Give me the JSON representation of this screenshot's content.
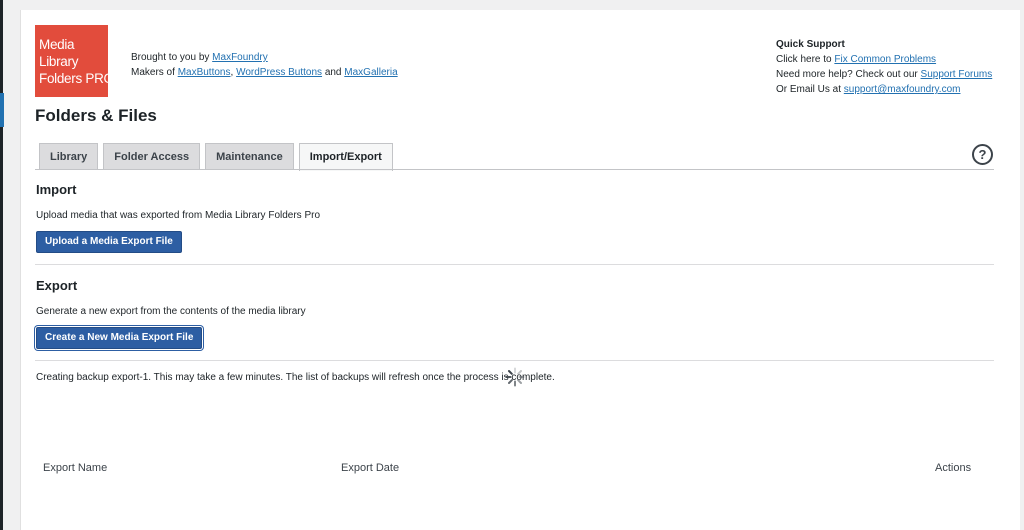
{
  "logo": {
    "lines": [
      "Media",
      "Library",
      "Folders PRO"
    ]
  },
  "credits": {
    "brought_prefix": "Brought to you by",
    "brought_link": "MaxFoundry",
    "makers_prefix": "Makers of",
    "maxbuttons": "MaxButtons",
    "comma": ",",
    "wordpress_buttons": "WordPress Buttons",
    "and": "and",
    "maxgalleria": "MaxGalleria"
  },
  "support": {
    "title": "Quick Support",
    "click_prefix": "Click here to",
    "fix_link": "Fix Common Problems",
    "help_prefix": "Need more help? Check out our",
    "forums_link": "Support Forums",
    "email_prefix": "Or Email Us at",
    "email_link": "support@maxfoundry.com"
  },
  "page_title": "Folders & Files",
  "tabs": [
    {
      "label": "Library",
      "active": false
    },
    {
      "label": "Folder Access",
      "active": false
    },
    {
      "label": "Maintenance",
      "active": false
    },
    {
      "label": "Import/Export",
      "active": true
    }
  ],
  "help_glyph": "?",
  "import": {
    "heading": "Import",
    "description": "Upload media that was exported from Media Library Folders Pro",
    "button": "Upload a Media Export File"
  },
  "export": {
    "heading": "Export",
    "description": "Generate a new export from the contents of the media library",
    "button": "Create a New Media Export File"
  },
  "status_message": "Creating backup export-1. This may take a few minutes. The list of backups will refresh once the process is complete.",
  "table": {
    "columns": [
      "Export Name",
      "Export Date",
      "Actions"
    ]
  },
  "colors": {
    "logo_bg": "#e24c3c",
    "button_bg": "#2d5ea3",
    "link": "#2271b1"
  }
}
